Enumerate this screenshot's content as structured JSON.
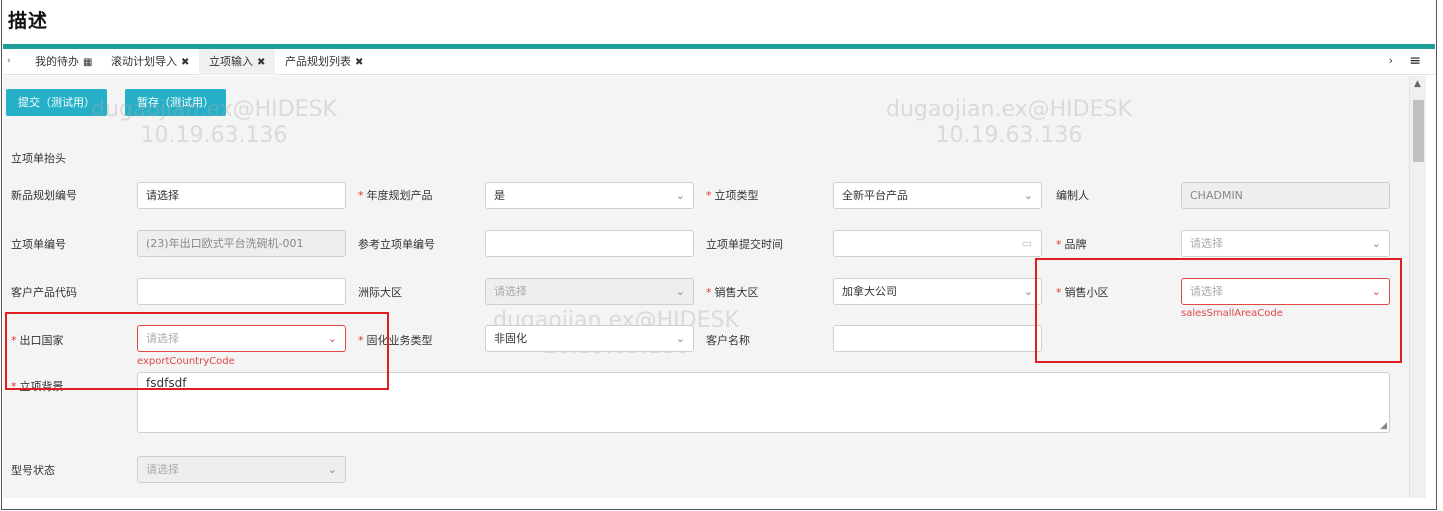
{
  "page": {
    "title": "描述"
  },
  "tabs": {
    "left_arrow": "‹",
    "items": [
      {
        "label": "我的待办",
        "icon": "calendar-icon",
        "active": false
      },
      {
        "label": "滚动计划导入",
        "close": "✖",
        "active": false
      },
      {
        "label": "立项输入",
        "close": "✖",
        "active": true
      },
      {
        "label": "产品规划列表",
        "close": "✖",
        "active": false
      }
    ],
    "right_arrow": "›",
    "menu": "≡"
  },
  "toolbar": {
    "submit_label": "提交（测试用）",
    "save_label": "暂存（测试用）"
  },
  "watermark": {
    "user": "dugaojian.ex@HIDESK",
    "ip": "10.19.63.136"
  },
  "form": {
    "section_title": "立项单抬头",
    "new_plan_no": {
      "label": "新品规划编号",
      "value": "请选择"
    },
    "annual_plan_product": {
      "label": "年度规划产品",
      "value": "是"
    },
    "project_type": {
      "label": "立项类型",
      "value": "全新平台产品"
    },
    "editor": {
      "label": "编制人",
      "value": "CHADMIN"
    },
    "project_no": {
      "label": "立项单编号",
      "value": "(23)年出口欧式平台洗碗机-001"
    },
    "ref_project_no": {
      "label": "参考立项单编号",
      "value": ""
    },
    "submit_time": {
      "label": "立项单提交时间",
      "value": ""
    },
    "brand": {
      "label": "品牌",
      "placeholder": "请选择"
    },
    "customer_product_code": {
      "label": "客户产品代码",
      "value": ""
    },
    "continent": {
      "label": "洲际大区",
      "placeholder": "请选择"
    },
    "sales_region": {
      "label": "销售大区",
      "value": "加拿大公司"
    },
    "sales_subregion": {
      "label": "销售小区",
      "placeholder": "请选择",
      "error": "salesSmallAreaCode"
    },
    "export_country": {
      "label": "出口国家",
      "placeholder": "请选择",
      "error": "exportCountryCode"
    },
    "solidify_type": {
      "label": "固化业务类型",
      "value": "非固化"
    },
    "customer_name": {
      "label": "客户名称",
      "value": ""
    },
    "background": {
      "label": "立项背景",
      "value": "fsdfsdf"
    },
    "model_status": {
      "label": "型号状态",
      "placeholder": "请选择"
    }
  },
  "colors": {
    "accent": "#1e9e9a",
    "button": "#26b0c8",
    "error": "#e04848",
    "required": "#e03131"
  }
}
